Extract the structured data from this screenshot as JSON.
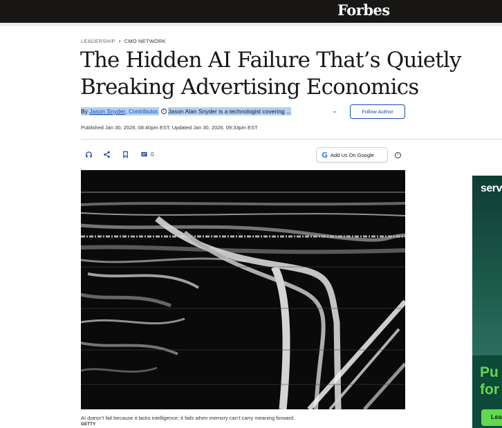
{
  "header": {
    "logo": "Forbes"
  },
  "breadcrumb": {
    "section": "LEADERSHIP",
    "subsection": "CMO NETWORK"
  },
  "article": {
    "title": "The Hidden AI Failure That’s Quietly Breaking Advertising Economics",
    "byline_prefix": "By",
    "author": "Jason Snyder",
    "author_role": "Contributor.",
    "author_bio": "Jason Alan Snyder is a technologist covering ...",
    "follow_label": "Follow Author",
    "dateline": "Published Jan 30, 2026, 08:40pm EST, Updated Jan 30, 2026, 09:33pm EST",
    "comment_count": "0",
    "google_label": "Add Us On Google",
    "image_caption": "AI doesn’t fail because it lacks intelligence; it fails when memory can’t carry meaning forward.",
    "image_credit": "GETTY"
  },
  "ad": {
    "brand": "serv",
    "headline_line1": "Pu",
    "headline_line2": "for",
    "cta": "Lea"
  },
  "icons": [
    "headphones-icon",
    "share-icon",
    "bookmark-icon",
    "comment-icon",
    "google-icon",
    "info-icon",
    "chevron-down-icon"
  ],
  "colors": {
    "accent": "#1a4da8",
    "topbar": "#181716",
    "selection": "#b4d0f5",
    "ad_green": "#62d84e"
  }
}
